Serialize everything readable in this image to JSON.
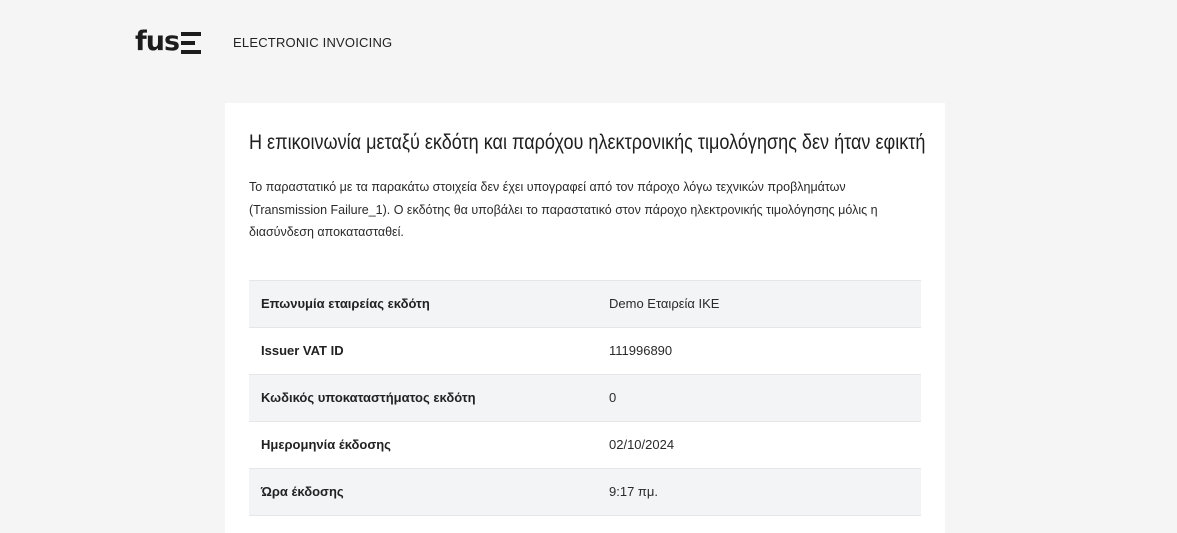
{
  "header": {
    "logo_text": "fus",
    "subtitle": "ELECTRONIC INVOICING"
  },
  "card": {
    "title": "Η επικοινωνία μεταξύ εκδότη και παρόχου ηλεκτρονικής τιμολόγησης δεν ήταν εφικτή",
    "description": "Το παραστατικό με τα παρακάτω στοιχεία δεν έχει υπογραφεί από τον πάροχο λόγω τεχνικών προβλημάτων (Transmission Failure_1). Ο εκδότης θα υποβάλει το παραστατικό στον πάροχο ηλεκτρονικής τιμολόγησης μόλις η διασύνδεση αποκατασταθεί.",
    "rows": [
      {
        "label": "Επωνυμία εταιρείας εκδότη",
        "value": "Demo Εταιρεία ΙΚΕ"
      },
      {
        "label": "Issuer VAT ID",
        "value": "111996890"
      },
      {
        "label": "Κωδικός υποκαταστήματος εκδότη",
        "value": "0"
      },
      {
        "label": "Ημερομηνία έκδοσης",
        "value": "02/10/2024"
      },
      {
        "label": "Ώρα έκδοσης",
        "value": "9:17 πμ."
      }
    ]
  }
}
